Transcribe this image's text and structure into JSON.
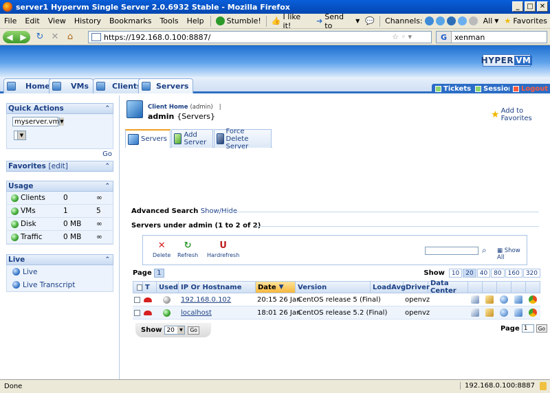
{
  "window": {
    "title": "server1 Hypervm Single Server 2.0.6932 Stable - Mozilla Firefox"
  },
  "menu": {
    "items": [
      "File",
      "Edit",
      "View",
      "History",
      "Bookmarks",
      "Tools",
      "Help"
    ],
    "toolbar": {
      "stumble": "Stumble!",
      "like": "I like it!",
      "send": "Send to",
      "channels": "Channels:",
      "all": "All",
      "favorites": "Favorites"
    }
  },
  "nav": {
    "url": "https://192.168.0.100:8887/",
    "search_engine": "G",
    "search_text": "xenman"
  },
  "app": {
    "logo": "HYPER",
    "logo_vm": "VM",
    "tabs": [
      "Home",
      "VMs",
      "Clients",
      "Servers"
    ],
    "right_tabs": [
      "Tickets",
      "Session",
      "Logout"
    ]
  },
  "sidebar": {
    "quick_actions": {
      "title": "Quick Actions",
      "select_value": "myserver.vm",
      "go": "Go"
    },
    "favorites": {
      "title": "Favorites",
      "edit": "[edit]"
    },
    "usage": {
      "title": "Usage",
      "rows": [
        {
          "name": "Clients",
          "used": "0",
          "max": "∞"
        },
        {
          "name": "VMs",
          "used": "1",
          "max": "5"
        },
        {
          "name": "Disk",
          "used": "0 MB",
          "max": "∞"
        },
        {
          "name": "Traffic",
          "used": "0 MB",
          "max": "∞"
        }
      ]
    },
    "live": {
      "title": "Live",
      "items": [
        "Live",
        "Live Transcript"
      ]
    }
  },
  "main": {
    "crumb_link": "Client Home",
    "crumb_user": "(admin)",
    "crumb_sep": "|",
    "title_user": "admin",
    "title_section": "{Servers}",
    "add_favorites": "Add to Favorites",
    "subtabs": [
      "Servers",
      "Add Server",
      "Force Delete Server"
    ],
    "advanced_search": "Advanced Search",
    "show_hide": "Show/Hide",
    "servers_heading": "Servers under admin (1 to 2 of 2)",
    "tools": [
      "Delete",
      "Refresh",
      "Hardrefresh"
    ],
    "show_all": "Show All",
    "page_label": "Page",
    "page_num": "1",
    "show_label": "Show",
    "show_options": [
      "10",
      "20",
      "40",
      "80",
      "160",
      "320"
    ],
    "show_selected": "20",
    "columns": [
      "T",
      "Used",
      "IP Or Hostname",
      "Date",
      "Version",
      "LoadAvg",
      "Driver",
      "Data Center"
    ],
    "rows": [
      {
        "host": "192.168.0.102",
        "date": "20:15 26 Jan",
        "version": "CentOS release 5 (Final)",
        "load": "",
        "driver": "openvz",
        "dc": ""
      },
      {
        "host": "localhost",
        "date": "18:01 26 Jan",
        "version": "CentOS release 5.2 (Final)",
        "load": "",
        "driver": "openvz",
        "dc": ""
      }
    ],
    "footer_show": "Show",
    "footer_select": "20",
    "footer_go": "Go",
    "footer_page": "Page",
    "footer_page_value": "1",
    "footer_page_go": "Go"
  },
  "status": {
    "left": "Done",
    "right": "192.168.0.100:8887"
  }
}
